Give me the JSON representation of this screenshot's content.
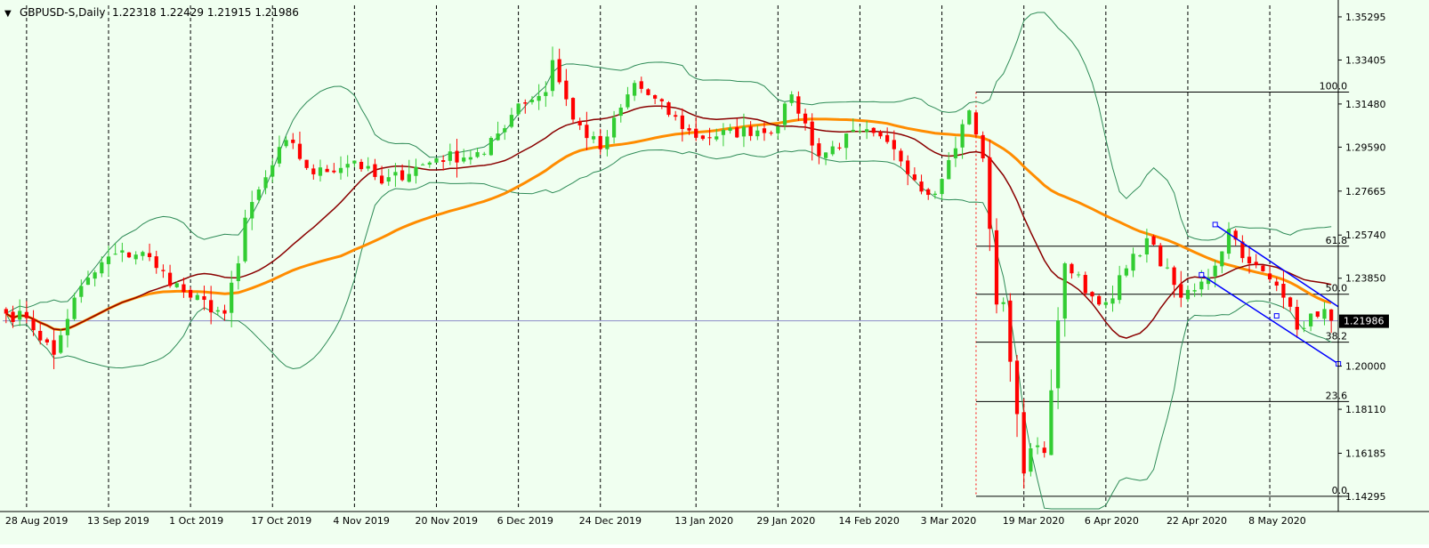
{
  "header": {
    "menu_glyph": "▼",
    "symbol": "GBPUSD-S,Daily",
    "ohlc": "1.22318 1.22429 1.21915 1.21986"
  },
  "colors": {
    "background": "#f0fff0",
    "bull_candle": "#32cd32",
    "bear_candle": "#ff0000",
    "bollinger": "#2e8b57",
    "ma_short": "#8b0000",
    "ma_long": "#ff8c00",
    "channel": "#0000ff",
    "fibonacci": "#000000",
    "bid_line": "#8c8cc8"
  },
  "chart_data": {
    "type": "candlestick",
    "title": "GBPUSD-S,Daily",
    "xlabel": "",
    "ylabel": "",
    "grid": true,
    "ylim": [
      1.1375,
      1.358
    ],
    "y_ticks": [
      "1.35295",
      "1.33405",
      "1.31480",
      "1.29590",
      "1.27665",
      "1.25740",
      "1.23850",
      "1.20000",
      "1.18110",
      "1.16185",
      "1.14295"
    ],
    "x_ticks": [
      "28 Aug 2019",
      "13 Sep 2019",
      "1 Oct 2019",
      "17 Oct 2019",
      "4 Nov 2019",
      "20 Nov 2019",
      "6 Dec 2019",
      "24 Dec 2019",
      "13 Jan 2020",
      "29 Jan 2020",
      "14 Feb 2020",
      "3 Mar 2020",
      "19 Mar 2020",
      "6 Apr 2020",
      "22 Apr 2020",
      "8 May 2020"
    ],
    "current_price": "1.21986",
    "anchors": [
      {
        "date": "23 Aug 2019",
        "close": 1.223
      },
      {
        "date": "28 Aug 2019",
        "close": 1.221
      },
      {
        "date": "3 Sep 2019",
        "close": 1.205
      },
      {
        "date": "6 Sep 2019",
        "close": 1.23
      },
      {
        "date": "13 Sep 2019",
        "close": 1.248
      },
      {
        "date": "20 Sep 2019",
        "close": 1.25
      },
      {
        "date": "24 Sep 2019",
        "close": 1.243
      },
      {
        "date": "1 Oct 2019",
        "close": 1.23
      },
      {
        "date": "8 Oct 2019",
        "close": 1.223
      },
      {
        "date": "10 Oct 2019",
        "close": 1.245
      },
      {
        "date": "11 Oct 2019",
        "close": 1.265
      },
      {
        "date": "17 Oct 2019",
        "close": 1.288
      },
      {
        "date": "21 Oct 2019",
        "close": 1.299
      },
      {
        "date": "25 Oct 2019",
        "close": 1.284
      },
      {
        "date": "4 Nov 2019",
        "close": 1.29
      },
      {
        "date": "8 Nov 2019",
        "close": 1.28
      },
      {
        "date": "20 Nov 2019",
        "close": 1.291
      },
      {
        "date": "29 Nov 2019",
        "close": 1.293
      },
      {
        "date": "6 Dec 2019",
        "close": 1.315
      },
      {
        "date": "12 Dec 2019",
        "close": 1.32
      },
      {
        "date": "13 Dec 2019",
        "close": 1.334
      },
      {
        "date": "18 Dec 2019",
        "close": 1.308
      },
      {
        "date": "24 Dec 2019",
        "close": 1.295
      },
      {
        "date": "31 Dec 2019",
        "close": 1.324
      },
      {
        "date": "13 Jan 2020",
        "close": 1.3
      },
      {
        "date": "29 Jan 2020",
        "close": 1.305
      },
      {
        "date": "31 Jan 2020",
        "close": 1.319
      },
      {
        "date": "6 Feb 2020",
        "close": 1.292
      },
      {
        "date": "14 Feb 2020",
        "close": 1.303
      },
      {
        "date": "21 Feb 2020",
        "close": 1.295
      },
      {
        "date": "28 Feb 2020",
        "close": 1.275
      },
      {
        "date": "3 Mar 2020",
        "close": 1.282
      },
      {
        "date": "9 Mar 2020",
        "close": 1.312
      },
      {
        "date": "11 Mar 2020",
        "close": 1.291
      },
      {
        "date": "13 Mar 2020",
        "close": 1.227
      },
      {
        "date": "16 Mar 2020",
        "close": 1.228
      },
      {
        "date": "18 Mar 2020",
        "close": 1.179
      },
      {
        "date": "19 Mar 2020",
        "close": 1.153
      },
      {
        "date": "20 Mar 2020",
        "close": 1.164
      },
      {
        "date": "24 Mar 2020",
        "close": 1.162
      },
      {
        "date": "26 Mar 2020",
        "close": 1.22
      },
      {
        "date": "27 Mar 2020",
        "close": 1.245
      },
      {
        "date": "3 Apr 2020",
        "close": 1.227
      },
      {
        "date": "6 Apr 2020",
        "close": 1.228
      },
      {
        "date": "14 Apr 2020",
        "close": 1.256
      },
      {
        "date": "21 Apr 2020",
        "close": 1.23
      },
      {
        "date": "24 Apr 2020",
        "close": 1.237
      },
      {
        "date": "28 Apr 2020",
        "close": 1.244
      },
      {
        "date": "30 Apr 2020",
        "close": 1.26
      },
      {
        "date": "5 May 2020",
        "close": 1.245
      },
      {
        "date": "8 May 2020",
        "close": 1.238
      },
      {
        "date": "13 May 2020",
        "close": 1.226
      },
      {
        "date": "14 May 2020",
        "close": 1.216
      },
      {
        "date": "18 May 2020",
        "close": 1.223
      },
      {
        "date": "20 May 2020",
        "close": 1.225
      },
      {
        "date": "21 May 2020",
        "close": 1.2199
      }
    ],
    "fibonacci": {
      "high": 1.32,
      "low": 1.143,
      "start_date": "10 Mar 2020",
      "end_date": "21 May 2020",
      "levels": [
        {
          "label": "100.0",
          "price": 1.32
        },
        {
          "label": "61.8",
          "price": 1.2525
        },
        {
          "label": "50.0",
          "price": 1.2315
        },
        {
          "label": "38.2",
          "price": 1.2105
        },
        {
          "label": "23.6",
          "price": 1.1845
        },
        {
          "label": "0.0",
          "price": 1.143
        }
      ]
    },
    "channel": [
      {
        "from_date": "28 Apr 2020",
        "from_price": 1.262,
        "to_date": "21 May 2020",
        "to_price": 1.226
      },
      {
        "from_date": "24 Apr 2020",
        "from_price": 1.24,
        "to_date": "21 May 2020",
        "to_price": 1.201
      }
    ],
    "channel_handles": [
      {
        "date": "28 Apr 2020",
        "price": 1.262
      },
      {
        "date": "24 Apr 2020",
        "price": 1.24
      },
      {
        "date": "11 May 2020",
        "price": 1.222
      },
      {
        "date": "21 May 2020",
        "price": 1.201
      }
    ],
    "series": [
      {
        "role": "candles"
      },
      {
        "role": "moving_average_short"
      },
      {
        "role": "moving_average_long"
      },
      {
        "role": "bollinger_bands"
      }
    ]
  }
}
